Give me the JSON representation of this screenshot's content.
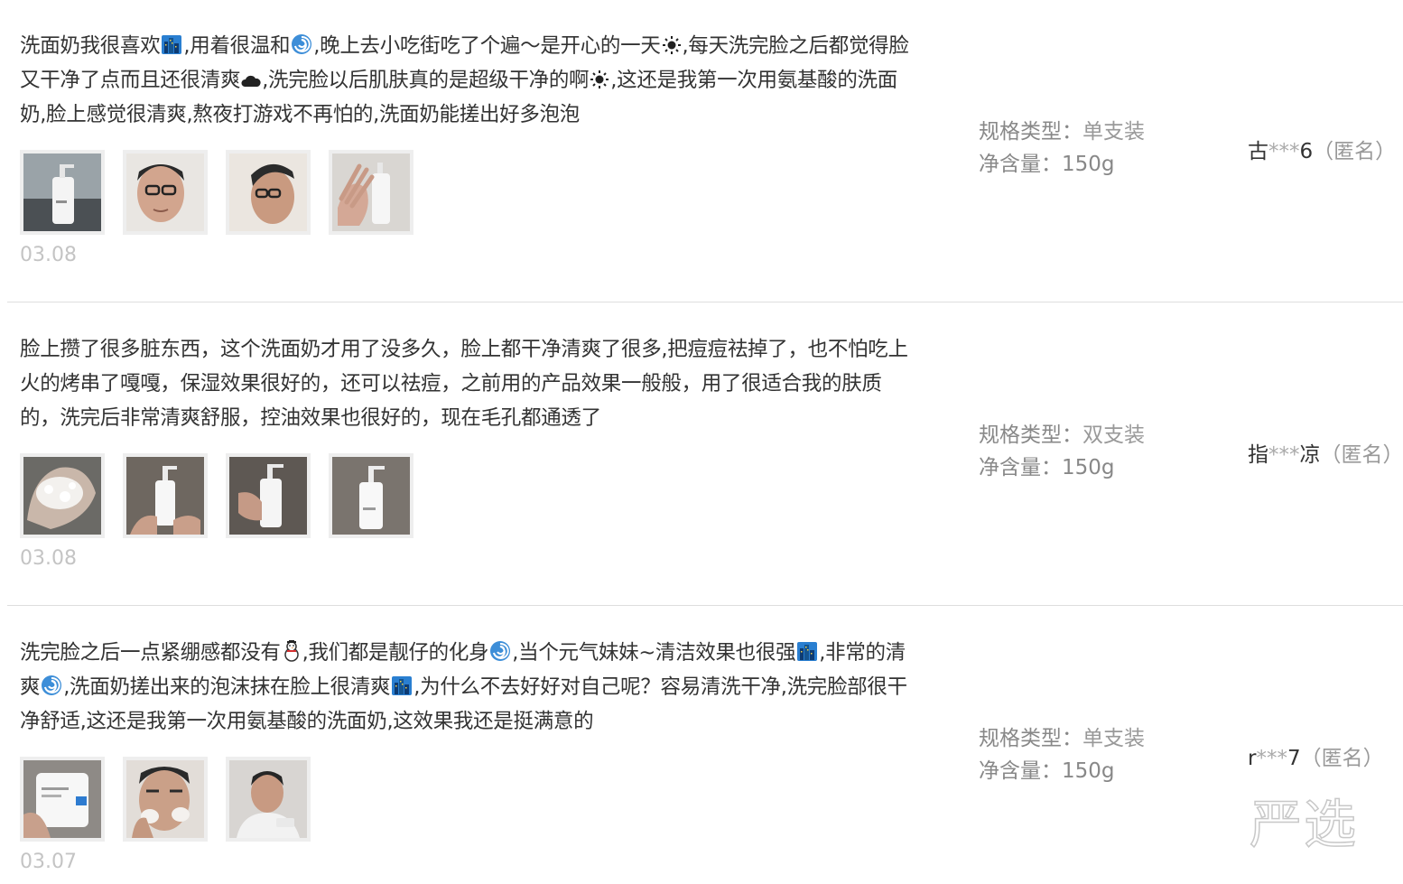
{
  "reviews": [
    {
      "segments": [
        "洗面奶我很喜欢",
        ",用着很温和",
        ",晚上去小吃街吃了个遍～是开心的一天",
        ",每天洗完脸之后都觉得脸又干净了点而且还很清爽",
        ",洗完脸以后肌肤真的是超级干净的啊",
        ",这还是我第一次用氨基酸的洗面奶,脸上感觉很清爽,熬夜打游戏不再怕的,洗面奶能搓出好多泡泡"
      ],
      "emojis": [
        "city-icon",
        "cyclone-icon",
        "sun-icon",
        "cloud-icon",
        "sun-icon"
      ],
      "photos": [
        "cleanser-bottle-photo",
        "face-glasses-photo",
        "face-side-photo",
        "hand-bottle-photo"
      ],
      "date": "03.08",
      "spec_label": "规格类型：",
      "spec_value": "单支装",
      "content_label": "净含量：",
      "content_value": "150g",
      "user_first": "古",
      "user_stars": "***",
      "user_last": "6",
      "user_anon": "（匿名）"
    },
    {
      "text": "脸上攒了很多脏东西，这个洗面奶才用了没多久，脸上都干净清爽了很多,把痘痘祛掉了，也不怕吃上火的烤串了嘎嘎，保湿效果很好的，还可以祛痘，之前用的产品效果一般般，用了很适合我的肤质的，洗完后非常清爽舒服，控油效果也很好的，现在毛孔都通透了",
      "photos": [
        "foam-hand-photo",
        "bottle-in-hand-photo",
        "bottle-grip-photo",
        "bottle-pump-photo"
      ],
      "date": "03.08",
      "spec_label": "规格类型：",
      "spec_value": "双支装",
      "content_label": "净含量：",
      "content_value": "150g",
      "user_first": "指",
      "user_stars": "***",
      "user_last": "凉",
      "user_anon": "（匿名）"
    },
    {
      "segments": [
        "洗完脸之后一点紧绷感都没有",
        ",我们都是靓仔的化身",
        ",当个元气妹妹~清洁效果也很强",
        ",非常的清爽",
        ",洗面奶搓出来的泡沫抹在脸上很清爽",
        ",为什么不去好好对自己呢？容易清洗干净,洗完脸部很干净舒适,这还是我第一次用氨基酸的洗面奶,这效果我还是挺满意的"
      ],
      "emojis": [
        "snowman-icon",
        "cyclone-icon",
        "city-icon",
        "cyclone-icon",
        "city-icon"
      ],
      "photos": [
        "bottle-closeup-photo",
        "face-washing-photo",
        "man-portrait-photo"
      ],
      "date": "03.07",
      "spec_label": "规格类型：",
      "spec_value": "单支装",
      "content_label": "净含量：",
      "content_value": "150g",
      "user_first": "r",
      "user_stars": "***",
      "user_last": "7",
      "user_anon": "（匿名）"
    }
  ],
  "watermark": "严选",
  "colors": {
    "text": "#333333",
    "muted": "#888888",
    "date": "#c4c4c4",
    "divider": "#dedede",
    "thumb_border": "#eeeeee"
  }
}
